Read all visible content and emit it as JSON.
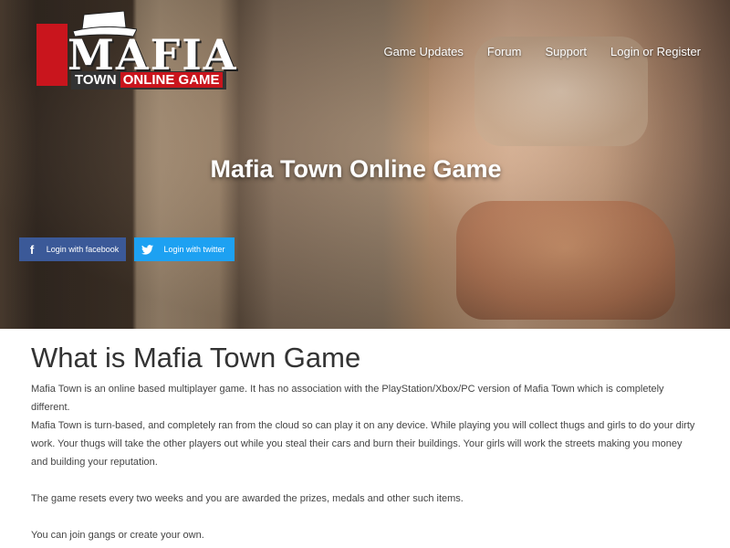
{
  "logo": {
    "title": "MAFIA",
    "subtitle_part1": "TOWN ",
    "subtitle_part2": "ONLINE GAME"
  },
  "nav": {
    "items": [
      "Game Updates",
      "Forum",
      "Support",
      "Login or Register"
    ]
  },
  "hero": {
    "title": "Mafia Town Online Game",
    "facebook_label": "Login with facebook",
    "twitter_label": "Login with twitter"
  },
  "about": {
    "heading": "What is Mafia Town Game",
    "paragraphs": [
      "Mafia Town is an online based multiplayer game. It has no association with the PlayStation/Xbox/PC version of Mafia Town which is completely different.",
      "Mafia Town is turn-based, and completely ran from the cloud so can play it on any device. While playing you will collect thugs and girls to do your dirty work. Your thugs will take the other players out while you steal their cars and burn their buildings. Your girls will work the streets making you money and building your reputation.",
      "The game resets every two weeks and you are awarded the prizes, medals and other such items.",
      "You can join gangs or create your own."
    ]
  },
  "colors": {
    "facebook": "#3b5998",
    "twitter": "#1da1f2",
    "logo_red": "#c9151d"
  },
  "icons": [
    "hat-icon",
    "facebook-icon",
    "twitter-icon"
  ]
}
